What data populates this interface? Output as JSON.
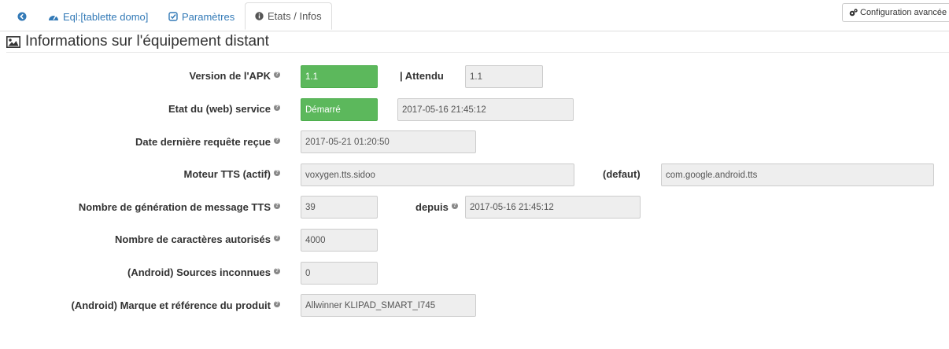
{
  "tabs": {
    "back_icon": "arrow-circle-left-icon",
    "equipment": "Eql:[tablette domo]",
    "settings": "Paramètres",
    "states": "Etats / Infos"
  },
  "advanced_config": "Configuration avancée",
  "legend": "Informations sur l'équipement distant",
  "rows": {
    "apk_version": {
      "label": "Version de l'APK",
      "value": "1.1",
      "expected_label": "| Attendu",
      "expected_value": "1.1"
    },
    "web_service": {
      "label": "Etat du (web) service",
      "value": "Démarré",
      "since": "2017-05-16 21:45:12"
    },
    "last_request": {
      "label": "Date dernière requête reçue",
      "value": "2017-05-21 01:20:50"
    },
    "tts_engine": {
      "label": "Moteur TTS (actif)",
      "value": "voxygen.tts.sidoo",
      "default_label": "(defaut)",
      "default_value": "com.google.android.tts"
    },
    "tts_count": {
      "label": "Nombre de génération de message TTS",
      "value": "39",
      "since_label": "depuis",
      "since_value": "2017-05-16 21:45:12"
    },
    "char_count": {
      "label": "Nombre de caractères autorisés",
      "value": "4000"
    },
    "unknown_sources": {
      "label": "(Android) Sources inconnues",
      "value": "0"
    },
    "product": {
      "label": "(Android) Marque et référence du produit",
      "value": "Allwinner KLIPAD_SMART_I745"
    }
  },
  "colors": {
    "link": "#337ab7",
    "success": "#5cb85c"
  }
}
